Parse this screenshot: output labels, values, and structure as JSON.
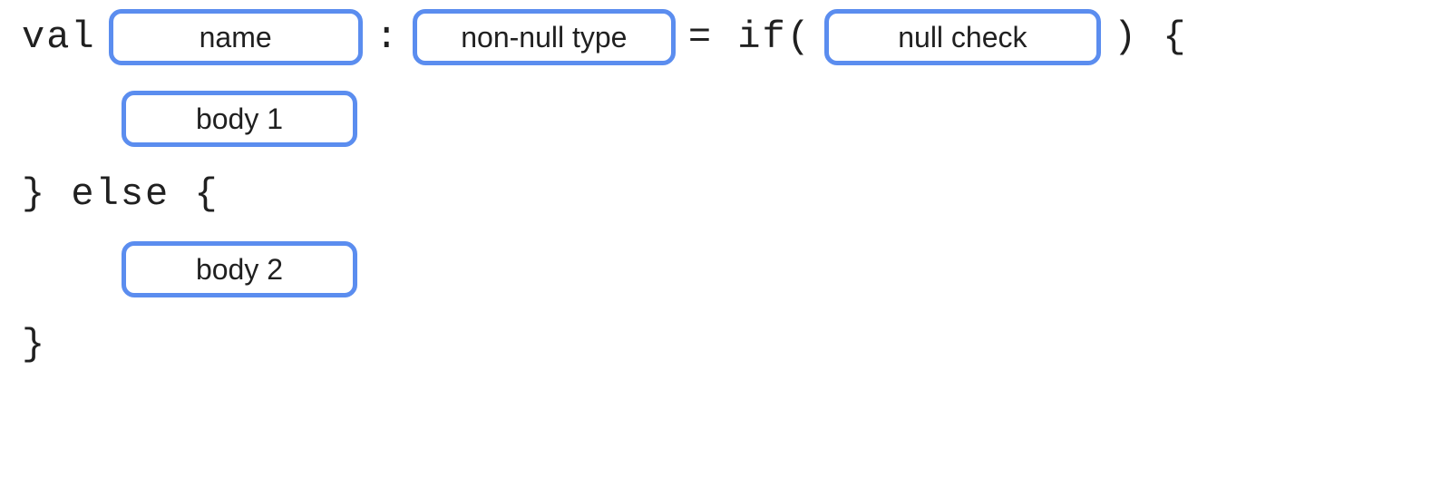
{
  "code": {
    "val": "val",
    "colon": ":",
    "equals_if_paren": "= if(",
    "paren_close_brace": ") {",
    "else_line": "} else {",
    "close_brace": "}"
  },
  "slots": {
    "name": "name",
    "type": "non-null type",
    "null_check": "null check",
    "body1": "body 1",
    "body2": "body 2"
  }
}
